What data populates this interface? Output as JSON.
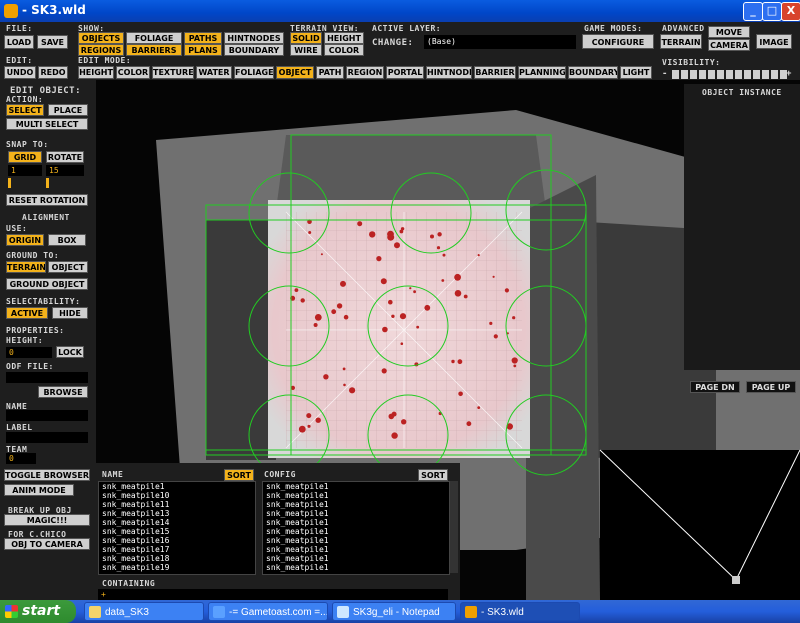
{
  "window": {
    "title": "- SK3.wld",
    "min": "_",
    "max": "□",
    "close": "X"
  },
  "top": {
    "file_label": "File:",
    "load": "Load",
    "save": "Save",
    "show_label": "Show:",
    "show_buttons": [
      "Objects",
      "Foliage",
      "Paths",
      "HintNodes",
      "Regions",
      "Barriers",
      "Plans",
      "Boundary"
    ],
    "terrain_view_label": "Terrain View:",
    "terrain_buttons": [
      "Solid",
      "Height",
      "Wire",
      "Color"
    ],
    "active_layer_label": "Active Layer:",
    "change_label": "CHANGE:",
    "active_layer_value": "(Base)",
    "game_modes_label": "Game Modes:",
    "configure": "Configure",
    "advanced_label": "Advanced",
    "terrain": "Terrain",
    "move": "Move",
    "camera": "Camera",
    "image": "Image",
    "edit_label": "Edit:",
    "undo": "Undo",
    "redo": "Redo",
    "edit_mode_label": "Edit Mode:",
    "edit_modes": [
      "Height",
      "Color",
      "Texture",
      "Water",
      "Foliage",
      "Object",
      "Path",
      "Region",
      "Portal",
      "HintNode",
      "Barrier",
      "Planning",
      "Boundary",
      "Light"
    ],
    "visibility_label": "Visibility:",
    "vis_minus": "-",
    "vis_plus": "+"
  },
  "left": {
    "title": "Edit Object:",
    "action_label": "Action:",
    "select": "Select",
    "place": "Place",
    "multi_select": "Multi Select",
    "snap_label": "Snap To:",
    "grid": "Grid",
    "rotate": "Rotate",
    "grid_value": "1",
    "rotate_value": "15",
    "reset_rotation": "Reset Rotation",
    "alignment_label": "Alignment",
    "use_label": "Use:",
    "origin": "Origin",
    "box": "Box",
    "ground_to_label": "Ground To:",
    "terrain": "Terrain",
    "object": "Object",
    "ground_object": "Ground Object",
    "selectability_label": "Selectability:",
    "active": "Active",
    "hide": "Hide",
    "properties_label": "Properties:",
    "height_label": "Height:",
    "height_value": "0",
    "lock": "Lock",
    "odf_label": "Odf File:",
    "browse": "Browse",
    "name_label": "Name",
    "label_label": "Label",
    "team_label": "Team",
    "team_value": "0",
    "toggle_browser": "Toggle Browser",
    "anim_mode": "Anim Mode",
    "break_up": "Break Up Obj",
    "magic": "Magic!!!",
    "for_chico": "For C.Chico",
    "obj_to_camera": "Obj To Camera"
  },
  "right": {
    "object_instance": "Object Instance",
    "page_dn": "Page Dn",
    "page_up": "Page Up"
  },
  "browser": {
    "name_header": "Name",
    "sort": "Sort",
    "config_header": "Config",
    "containing": "Containing",
    "containing_value": "+",
    "names": [
      "snk_meatpile1",
      "snk_meatpile10",
      "snk_meatpile11",
      "snk_meatpile13",
      "snk_meatpile14",
      "snk_meatpile15",
      "snk_meatpile16",
      "snk_meatpile17",
      "snk_meatpile18",
      "snk_meatpile19"
    ],
    "configs": [
      "snk_meatpile1",
      "snk_meatpile1",
      "snk_meatpile1",
      "snk_meatpile1",
      "snk_meatpile1",
      "snk_meatpile1",
      "snk_meatpile1",
      "snk_meatpile1",
      "snk_meatpile1",
      "snk_meatpile1"
    ]
  },
  "taskbar": {
    "start": "start",
    "tasks": [
      "data_SK3",
      "-= Gametoast.com =...",
      "SK3g_eli - Notepad",
      "- SK3.wld"
    ]
  },
  "colors": {
    "accent": "#f3b21b",
    "button": "#cfcfcf",
    "panel": "#1e1e1e",
    "selection_green": "#22cc22"
  }
}
